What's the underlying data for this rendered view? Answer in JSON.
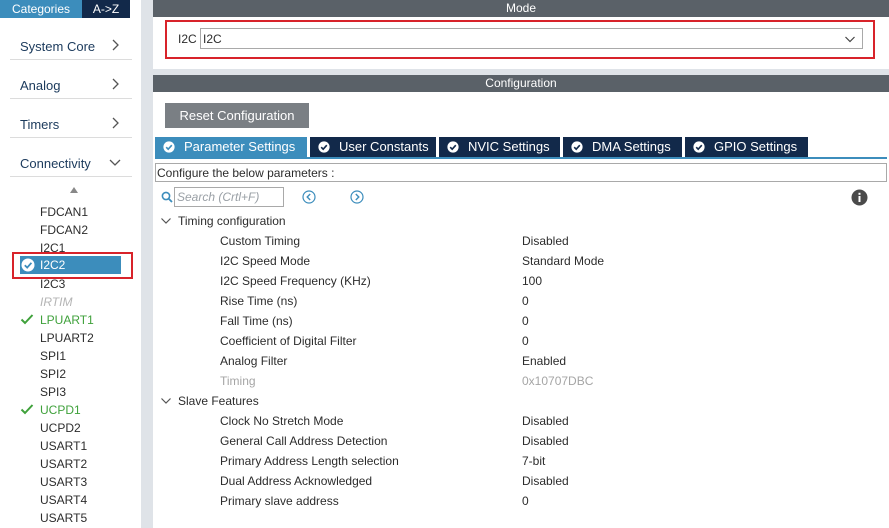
{
  "sidebar": {
    "tabs": {
      "categories": "Categories",
      "az": "A->Z"
    },
    "categories": [
      {
        "label": "System Core"
      },
      {
        "label": "Analog"
      },
      {
        "label": "Timers"
      },
      {
        "label": "Connectivity"
      }
    ],
    "items": [
      {
        "label": "FDCAN1",
        "state": "normal"
      },
      {
        "label": "FDCAN2",
        "state": "normal"
      },
      {
        "label": "I2C1",
        "state": "normal"
      },
      {
        "label": "I2C2",
        "state": "selected"
      },
      {
        "label": "I2C3",
        "state": "normal"
      },
      {
        "label": "IRTIM",
        "state": "disabled"
      },
      {
        "label": "LPUART1",
        "state": "configured"
      },
      {
        "label": "LPUART2",
        "state": "normal"
      },
      {
        "label": "SPI1",
        "state": "normal"
      },
      {
        "label": "SPI2",
        "state": "normal"
      },
      {
        "label": "SPI3",
        "state": "normal"
      },
      {
        "label": "UCPD1",
        "state": "configured"
      },
      {
        "label": "UCPD2",
        "state": "normal"
      },
      {
        "label": "USART1",
        "state": "normal"
      },
      {
        "label": "USART2",
        "state": "normal"
      },
      {
        "label": "USART3",
        "state": "normal"
      },
      {
        "label": "USART4",
        "state": "normal"
      },
      {
        "label": "USART5",
        "state": "normal"
      }
    ]
  },
  "mode": {
    "header": "Mode",
    "field_label": "I2C",
    "selected": "I2C"
  },
  "configuration": {
    "header": "Configuration",
    "reset_button": "Reset Configuration",
    "tabs": [
      {
        "label": "Parameter Settings",
        "active": true
      },
      {
        "label": "User Constants",
        "active": false
      },
      {
        "label": "NVIC Settings",
        "active": false
      },
      {
        "label": "DMA Settings",
        "active": false
      },
      {
        "label": "GPIO Settings",
        "active": false
      }
    ],
    "description": "Configure the below parameters :",
    "search_placeholder": "Search (Crtl+F)",
    "groups": [
      {
        "label": "Timing configuration",
        "params": [
          {
            "name": "Custom Timing",
            "value": "Disabled",
            "dim": false
          },
          {
            "name": "I2C Speed Mode",
            "value": "Standard Mode",
            "dim": false
          },
          {
            "name": "I2C Speed Frequency (KHz)",
            "value": "100",
            "dim": false
          },
          {
            "name": "Rise Time (ns)",
            "value": "0",
            "dim": false
          },
          {
            "name": "Fall Time (ns)",
            "value": "0",
            "dim": false
          },
          {
            "name": "Coefficient of Digital Filter",
            "value": "0",
            "dim": false
          },
          {
            "name": "Analog Filter",
            "value": "Enabled",
            "dim": false
          },
          {
            "name": "Timing",
            "value": "0x10707DBC",
            "dim": true
          }
        ]
      },
      {
        "label": "Slave Features",
        "params": [
          {
            "name": "Clock No Stretch Mode",
            "value": "Disabled",
            "dim": false
          },
          {
            "name": "General Call Address Detection",
            "value": "Disabled",
            "dim": false
          },
          {
            "name": "Primary Address Length selection",
            "value": "7-bit",
            "dim": false
          },
          {
            "name": "Dual Address Acknowledged",
            "value": "Disabled",
            "dim": false
          },
          {
            "name": "Primary slave address",
            "value": "0",
            "dim": false
          }
        ]
      }
    ]
  },
  "colors": {
    "accent": "#3c8dbc",
    "navy": "#12294a",
    "header_gray": "#5a6168",
    "ok_green": "#3fa13b",
    "highlight_red": "#d8232a"
  }
}
